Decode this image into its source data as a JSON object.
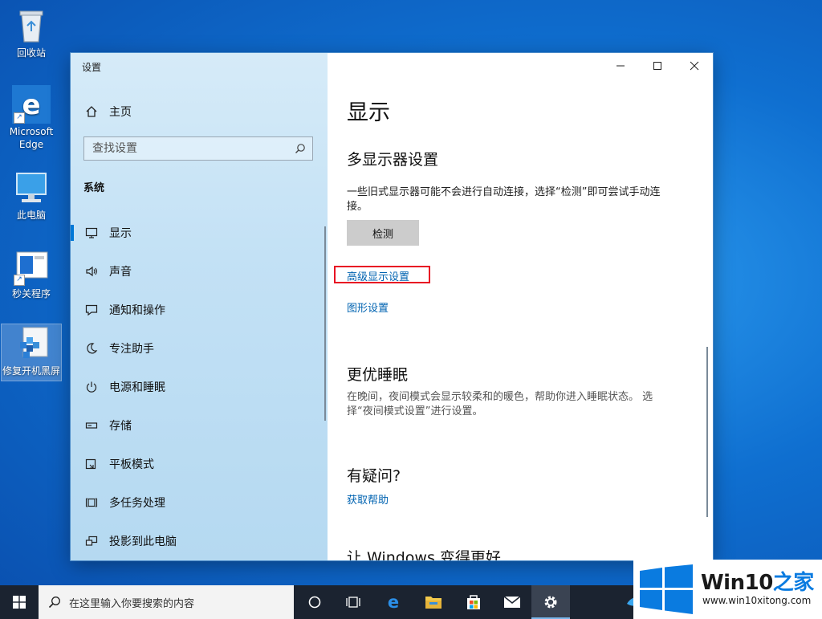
{
  "desktop": {
    "icons": [
      {
        "label": "回收站"
      },
      {
        "label": "Microsoft Edge"
      },
      {
        "label": "此电脑"
      },
      {
        "label": "秒关程序"
      },
      {
        "label": "修复开机黑屏"
      }
    ]
  },
  "window": {
    "title": "设置",
    "home_label": "主页",
    "search_placeholder": "查找设置",
    "section_label": "系统",
    "nav_items": [
      {
        "label": "显示",
        "icon": "monitor-icon",
        "active": true
      },
      {
        "label": "声音",
        "icon": "speaker-icon"
      },
      {
        "label": "通知和操作",
        "icon": "notification-icon"
      },
      {
        "label": "专注助手",
        "icon": "moon-icon"
      },
      {
        "label": "电源和睡眠",
        "icon": "power-icon"
      },
      {
        "label": "存储",
        "icon": "storage-icon"
      },
      {
        "label": "平板模式",
        "icon": "tablet-icon"
      },
      {
        "label": "多任务处理",
        "icon": "multitask-icon"
      },
      {
        "label": "投影到此电脑",
        "icon": "project-icon"
      }
    ],
    "content": {
      "page_title": "显示",
      "multi_display_heading": "多显示器设置",
      "multi_display_desc": "一些旧式显示器可能不会进行自动连接，选择“检测”即可尝试手动连接。",
      "detect_button": "检测",
      "advanced_link": "高级显示设置",
      "graphics_link": "图形设置",
      "sleep_heading": "更优睡眠",
      "sleep_desc": "在晚间，夜间模式会显示较柔和的暖色，帮助你进入睡眠状态。 选择“夜间模式设置”进行设置。",
      "question_heading": "有疑问?",
      "help_link": "获取帮助",
      "better_heading": "让 Windows 变得更好"
    }
  },
  "taskbar": {
    "search_placeholder": "在这里输入你要搜索的内容"
  },
  "watermark": {
    "title_prefix": "Win10",
    "title_suffix": "之家",
    "url": "www.win10xitong.com"
  },
  "colors": {
    "accent": "#0078d7",
    "link": "#0063b1",
    "highlight_box": "#e81123",
    "taskbar": "#1b2330"
  }
}
